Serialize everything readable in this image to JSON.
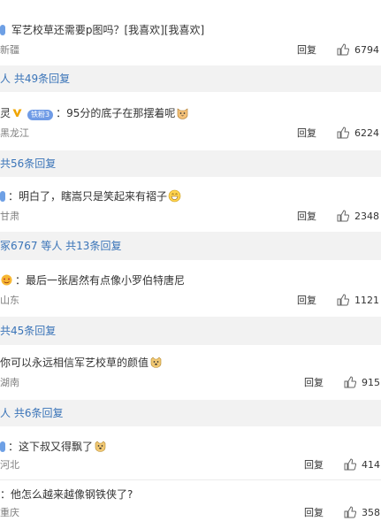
{
  "comments": [
    {
      "text": "军艺校草还需要p图吗？[我喜欢][我喜欢]",
      "location": "新疆",
      "reply_label": "回复",
      "likes": "6794"
    },
    {
      "prefix": "灵",
      "text": "：95分的底子在那摆着呢",
      "location": "黑龙江",
      "reply_label": "回复",
      "likes": "6224",
      "fan_badge": "铁粉3"
    },
    {
      "prefix": "：",
      "text": "明白了，瞎嵩只是笑起来有褶子",
      "location": "甘肃",
      "reply_label": "回复",
      "likes": "2348"
    },
    {
      "prefix": "：",
      "text": "最后一张居然有点像小罗伯特唐尼",
      "location": "山东",
      "reply_label": "回复",
      "likes": "1121"
    },
    {
      "text": "你可以永远相信军艺校草的颜值",
      "location": "湖南",
      "reply_label": "回复",
      "likes": "915"
    },
    {
      "prefix": "：",
      "text": "这下叔又得飘了",
      "location": "河北",
      "reply_label": "回复",
      "likes": "414"
    },
    {
      "prefix": "：",
      "text": "他怎么越来越像钢铁侠了?",
      "location": "重庆",
      "reply_label": "回复",
      "likes": "358"
    }
  ],
  "reply_bars": [
    "人 共49条回复",
    "共56条回复",
    "冢6767 等人 共13条回复",
    "共45条回复",
    "人 共6条回复"
  ],
  "colors": {
    "link": "#3a74b8",
    "muted": "#808080",
    "bar_bg": "#f2f2f2"
  },
  "icons": {
    "like": "thumbs-up-icon",
    "verified": "v-badge-icon",
    "emoji": "smile-face-icon"
  }
}
